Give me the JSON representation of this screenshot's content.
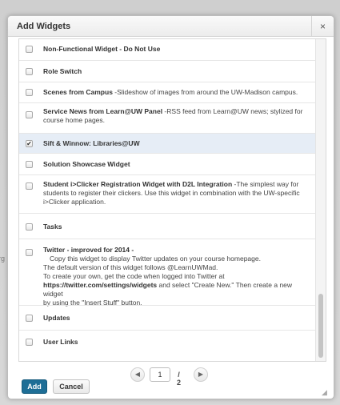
{
  "background": {
    "fragment_text": "rg"
  },
  "dialog": {
    "title": "Add Widgets",
    "close_label": "×"
  },
  "widgets": [
    {
      "name": "Non-Functional Widget - Do Not Use",
      "checked": false,
      "description_lines": []
    },
    {
      "name": "Role Switch",
      "checked": false,
      "description_lines": []
    },
    {
      "name": "Scenes from Campus",
      "checked": false,
      "inline_description": " -Slideshow of images from around the UW-Madison campus."
    },
    {
      "name": "Service News from Learn@UW Panel",
      "checked": false,
      "inline_description": " -RSS feed from Learn@UW news; stylized for",
      "description_lines": [
        "course home pages."
      ]
    },
    {
      "name": "Sift & Winnow: Libraries@UW",
      "checked": true,
      "description_lines": []
    },
    {
      "name": "Solution Showcase Widget",
      "checked": false,
      "description_lines": []
    },
    {
      "name": "Student i>Clicker Registration Widget with D2L Integration",
      "checked": false,
      "inline_description": " -The simplest way for",
      "description_lines": [
        "students to register their clickers. Use this widget in combination with the UW-specific",
        "i>Clicker application."
      ]
    },
    {
      "name": "Tasks",
      "checked": false,
      "description_lines": []
    },
    {
      "name": "Twitter - improved for 2014 -",
      "checked": false,
      "description_lines": [
        "Copy this widget to display Twitter updates on your course homepage.",
        "The default version of this widget follows @LearnUWMad.",
        "To create your own, get the code when logged into Twitter at",
        "https://twitter.com/settings/widgets",
        "by using the \"Insert Stuff\" button."
      ],
      "inline_after_url": " and select \"Create New.\" Then create a new widget"
    },
    {
      "name": "Updates",
      "checked": false,
      "description_lines": []
    },
    {
      "name": "User Links",
      "checked": false,
      "description_lines": []
    }
  ],
  "pagination": {
    "prev_icon": "◀",
    "next_icon": "▶",
    "current_page": "1",
    "total_label": "/ 2"
  },
  "footer": {
    "add_label": "Add",
    "cancel_label": "Cancel",
    "resize_icon": "◢"
  },
  "colors": {
    "primary": "#1e6e96",
    "selected_row": "#e6edf6"
  }
}
